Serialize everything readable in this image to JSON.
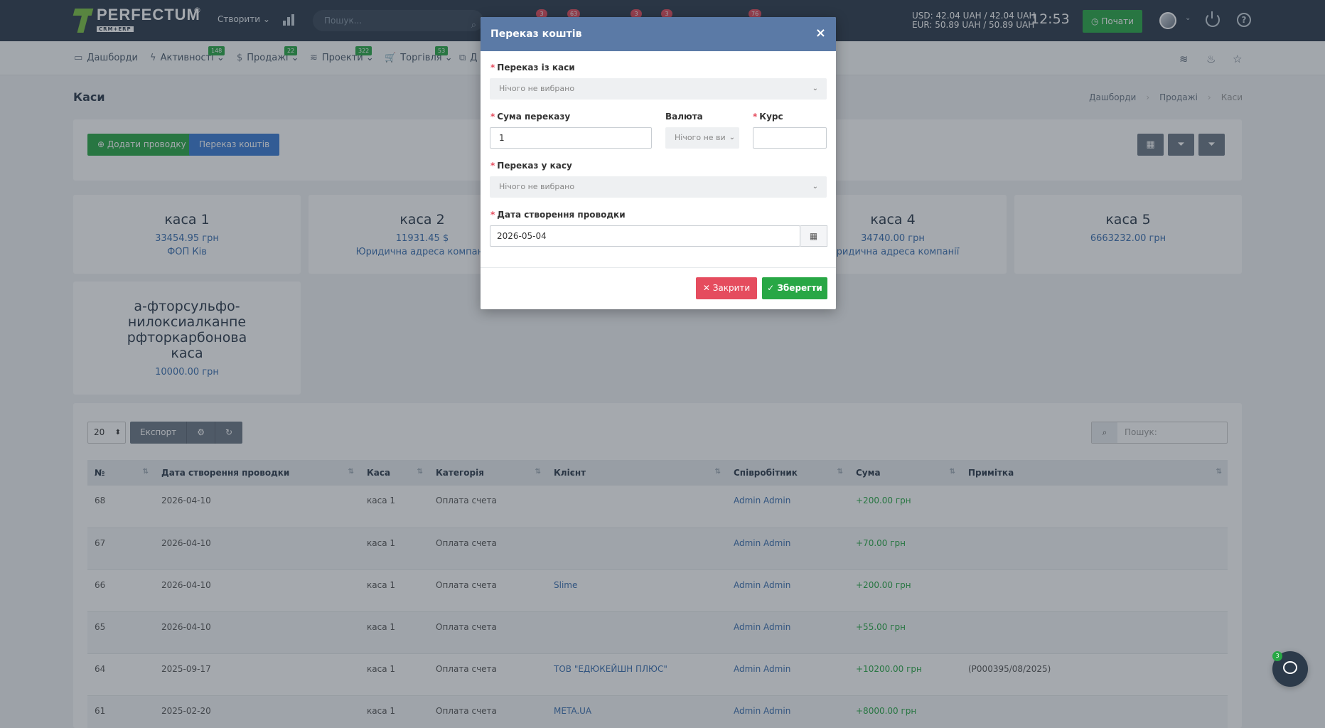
{
  "topbar": {
    "brand": "PERFECTUM",
    "brand_sub": "CRM+ERP",
    "brand_reg": "®",
    "create_label": "Створити",
    "search_placeholder": "Пошук...",
    "notification_counts": [
      "3",
      "63",
      "3",
      "3",
      "76"
    ],
    "rate_usd": "USD: 42.04 UAH / 42.04 UAH",
    "rate_eur": "EUR: 50.89 UAH / 50.89 UAH",
    "time": "12:53",
    "start_label": "Почати"
  },
  "subnav": {
    "items": [
      {
        "label": "Дашборди",
        "badge": ""
      },
      {
        "label": "Активності",
        "badge": "148"
      },
      {
        "label": "Продажі",
        "badge": "22"
      },
      {
        "label": "Проекти",
        "badge": "322"
      },
      {
        "label": "Торгівля",
        "badge": "53"
      },
      {
        "label": "Д",
        "badge": ""
      }
    ]
  },
  "page": {
    "title": "Каси",
    "breadcrumb": [
      "Дашборди",
      "Продажі",
      "Каси"
    ]
  },
  "actions": {
    "add_label": "Додати проводку",
    "transfer_label": "Переказ коштів"
  },
  "cards": [
    {
      "name": "каса 1",
      "sum": "33454.95 грн",
      "note": "ФОП Кiв"
    },
    {
      "name": "каса 2",
      "sum": "11931.45 $",
      "note": "Юридична адреса компанії"
    },
    {
      "name": "каса 4",
      "sum": "34740.00 грн",
      "note": "Юридична адреса компанії"
    },
    {
      "name": "каса 5",
      "sum": "6663232.00 грн",
      "note": ""
    },
    {
      "name": "а-фторсульфо-нилоксиалканпе рфторкарбонова каса",
      "sum": "10000.00 грн",
      "note": ""
    }
  ],
  "table": {
    "per_page": "20",
    "export_label": "Експорт",
    "search_placeholder": "Пошук:",
    "columns": [
      "№",
      "Дата створення проводки",
      "Каса",
      "Категорія",
      "Клієнт",
      "Співробітник",
      "Сума",
      "Примітка"
    ],
    "rows": [
      {
        "id": "68",
        "date": "2026-04-10",
        "cash": "каса 1",
        "category": "Оплата счета",
        "client": "",
        "employee": "Admin Admin",
        "amount": "+200.00 грн",
        "note": ""
      },
      {
        "id": "67",
        "date": "2026-04-10",
        "cash": "каса 1",
        "category": "Оплата счета",
        "client": "",
        "employee": "Admin Admin",
        "amount": "+70.00 грн",
        "note": ""
      },
      {
        "id": "66",
        "date": "2026-04-10",
        "cash": "каса 1",
        "category": "Оплата счета",
        "client": "Slime",
        "employee": "Admin Admin",
        "amount": "+200.00 грн",
        "note": ""
      },
      {
        "id": "65",
        "date": "2026-04-10",
        "cash": "каса 1",
        "category": "Оплата счета",
        "client": "",
        "employee": "Admin Admin",
        "amount": "+55.00 грн",
        "note": ""
      },
      {
        "id": "64",
        "date": "2025-09-17",
        "cash": "каса 1",
        "category": "Оплата счета",
        "client": "ТОВ \"ЕДЮКЕЙШН ПЛЮС\"",
        "employee": "Admin Admin",
        "amount": "+10200.00 грн",
        "note": "(P000395/08/2025)"
      },
      {
        "id": "61",
        "date": "2025-02-20",
        "cash": "каса 1",
        "category": "Оплата счета",
        "client": "META.UA",
        "employee": "Admin Admin",
        "amount": "+8000.00 грн",
        "note": ""
      }
    ]
  },
  "modal": {
    "title": "Переказ коштів",
    "close_glyph": "×",
    "from_label": "Переказ із каси",
    "from_value": "Нічого не вибрано",
    "amount_label": "Сума переказу",
    "amount_value": "1",
    "currency_label": "Валюта",
    "currency_value": "Нічого не ви",
    "rate_label": "Курс",
    "rate_value": "",
    "to_label": "Переказ у касу",
    "to_value": "Нічого не вибрано",
    "date_label": "Дата створення проводки",
    "date_value": "2026-05-04",
    "close_label": "Закрити",
    "save_label": "Зберегти"
  },
  "chat": {
    "badge": "3"
  }
}
